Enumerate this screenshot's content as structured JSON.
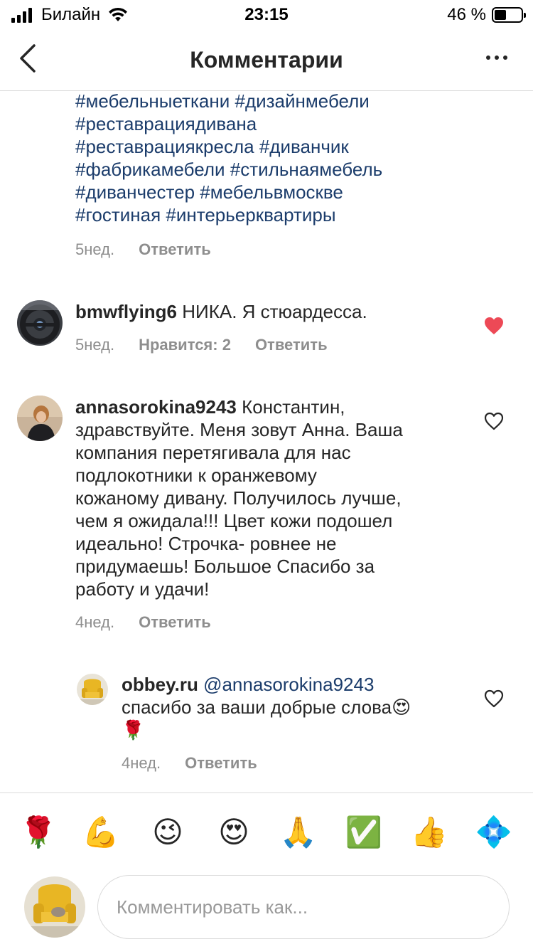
{
  "status_bar": {
    "carrier": "Билайн",
    "time": "23:15",
    "battery": "46 %"
  },
  "header": {
    "title": "Комментарии"
  },
  "comments": [
    {
      "text_lines": [
        "#мебельныеткани #дизайнмебели",
        "#реставрациядивана",
        "#реставрациякресла #диванчик",
        "#фабрикамебели #стильнаямебель",
        "#диванчестер #мебельвмоскве",
        "#гостиная #интерьерквартиры"
      ],
      "time": "5нед.",
      "reply_label": "Ответить"
    },
    {
      "username": "bmwflying6",
      "text": " НИКА. Я стюардесса.",
      "time": "5нед.",
      "likes_label": "Нравится: 2",
      "reply_label": "Ответить",
      "liked": true
    },
    {
      "username": "annasorokina9243",
      "text_first": " Константин,",
      "text_lines": [
        "здравствуйте. Меня зовут Анна. Ваша",
        "компания перетягивала для нас",
        "подлокотники к оранжевому",
        "кожаному дивану. Получилось лучше,",
        "чем я ожидала!!! Цвет кожи подошел",
        "идеально! Строчка- ровнее не",
        "придумаешь! Большое Спасибо за",
        "работу и удачи!"
      ],
      "time": "4нед.",
      "reply_label": "Ответить",
      "liked": false
    },
    {
      "username": "obbey.ru",
      "mention": " @annasorokina9243",
      "text": "спасибо за ваши добрые слова😍",
      "text2": "🌹",
      "time": "4нед.",
      "reply_label": "Ответить",
      "liked": false
    }
  ],
  "emoji_bar": [
    "🌹",
    "💪",
    "😉",
    "😍",
    "🙏",
    "✅",
    "👍",
    "💠"
  ],
  "comment_input": {
    "placeholder": "Комментировать как..."
  },
  "colors": {
    "link": "#1b3c6b",
    "like_red": "#ed4956",
    "meta_gray": "#8e8e8e"
  }
}
